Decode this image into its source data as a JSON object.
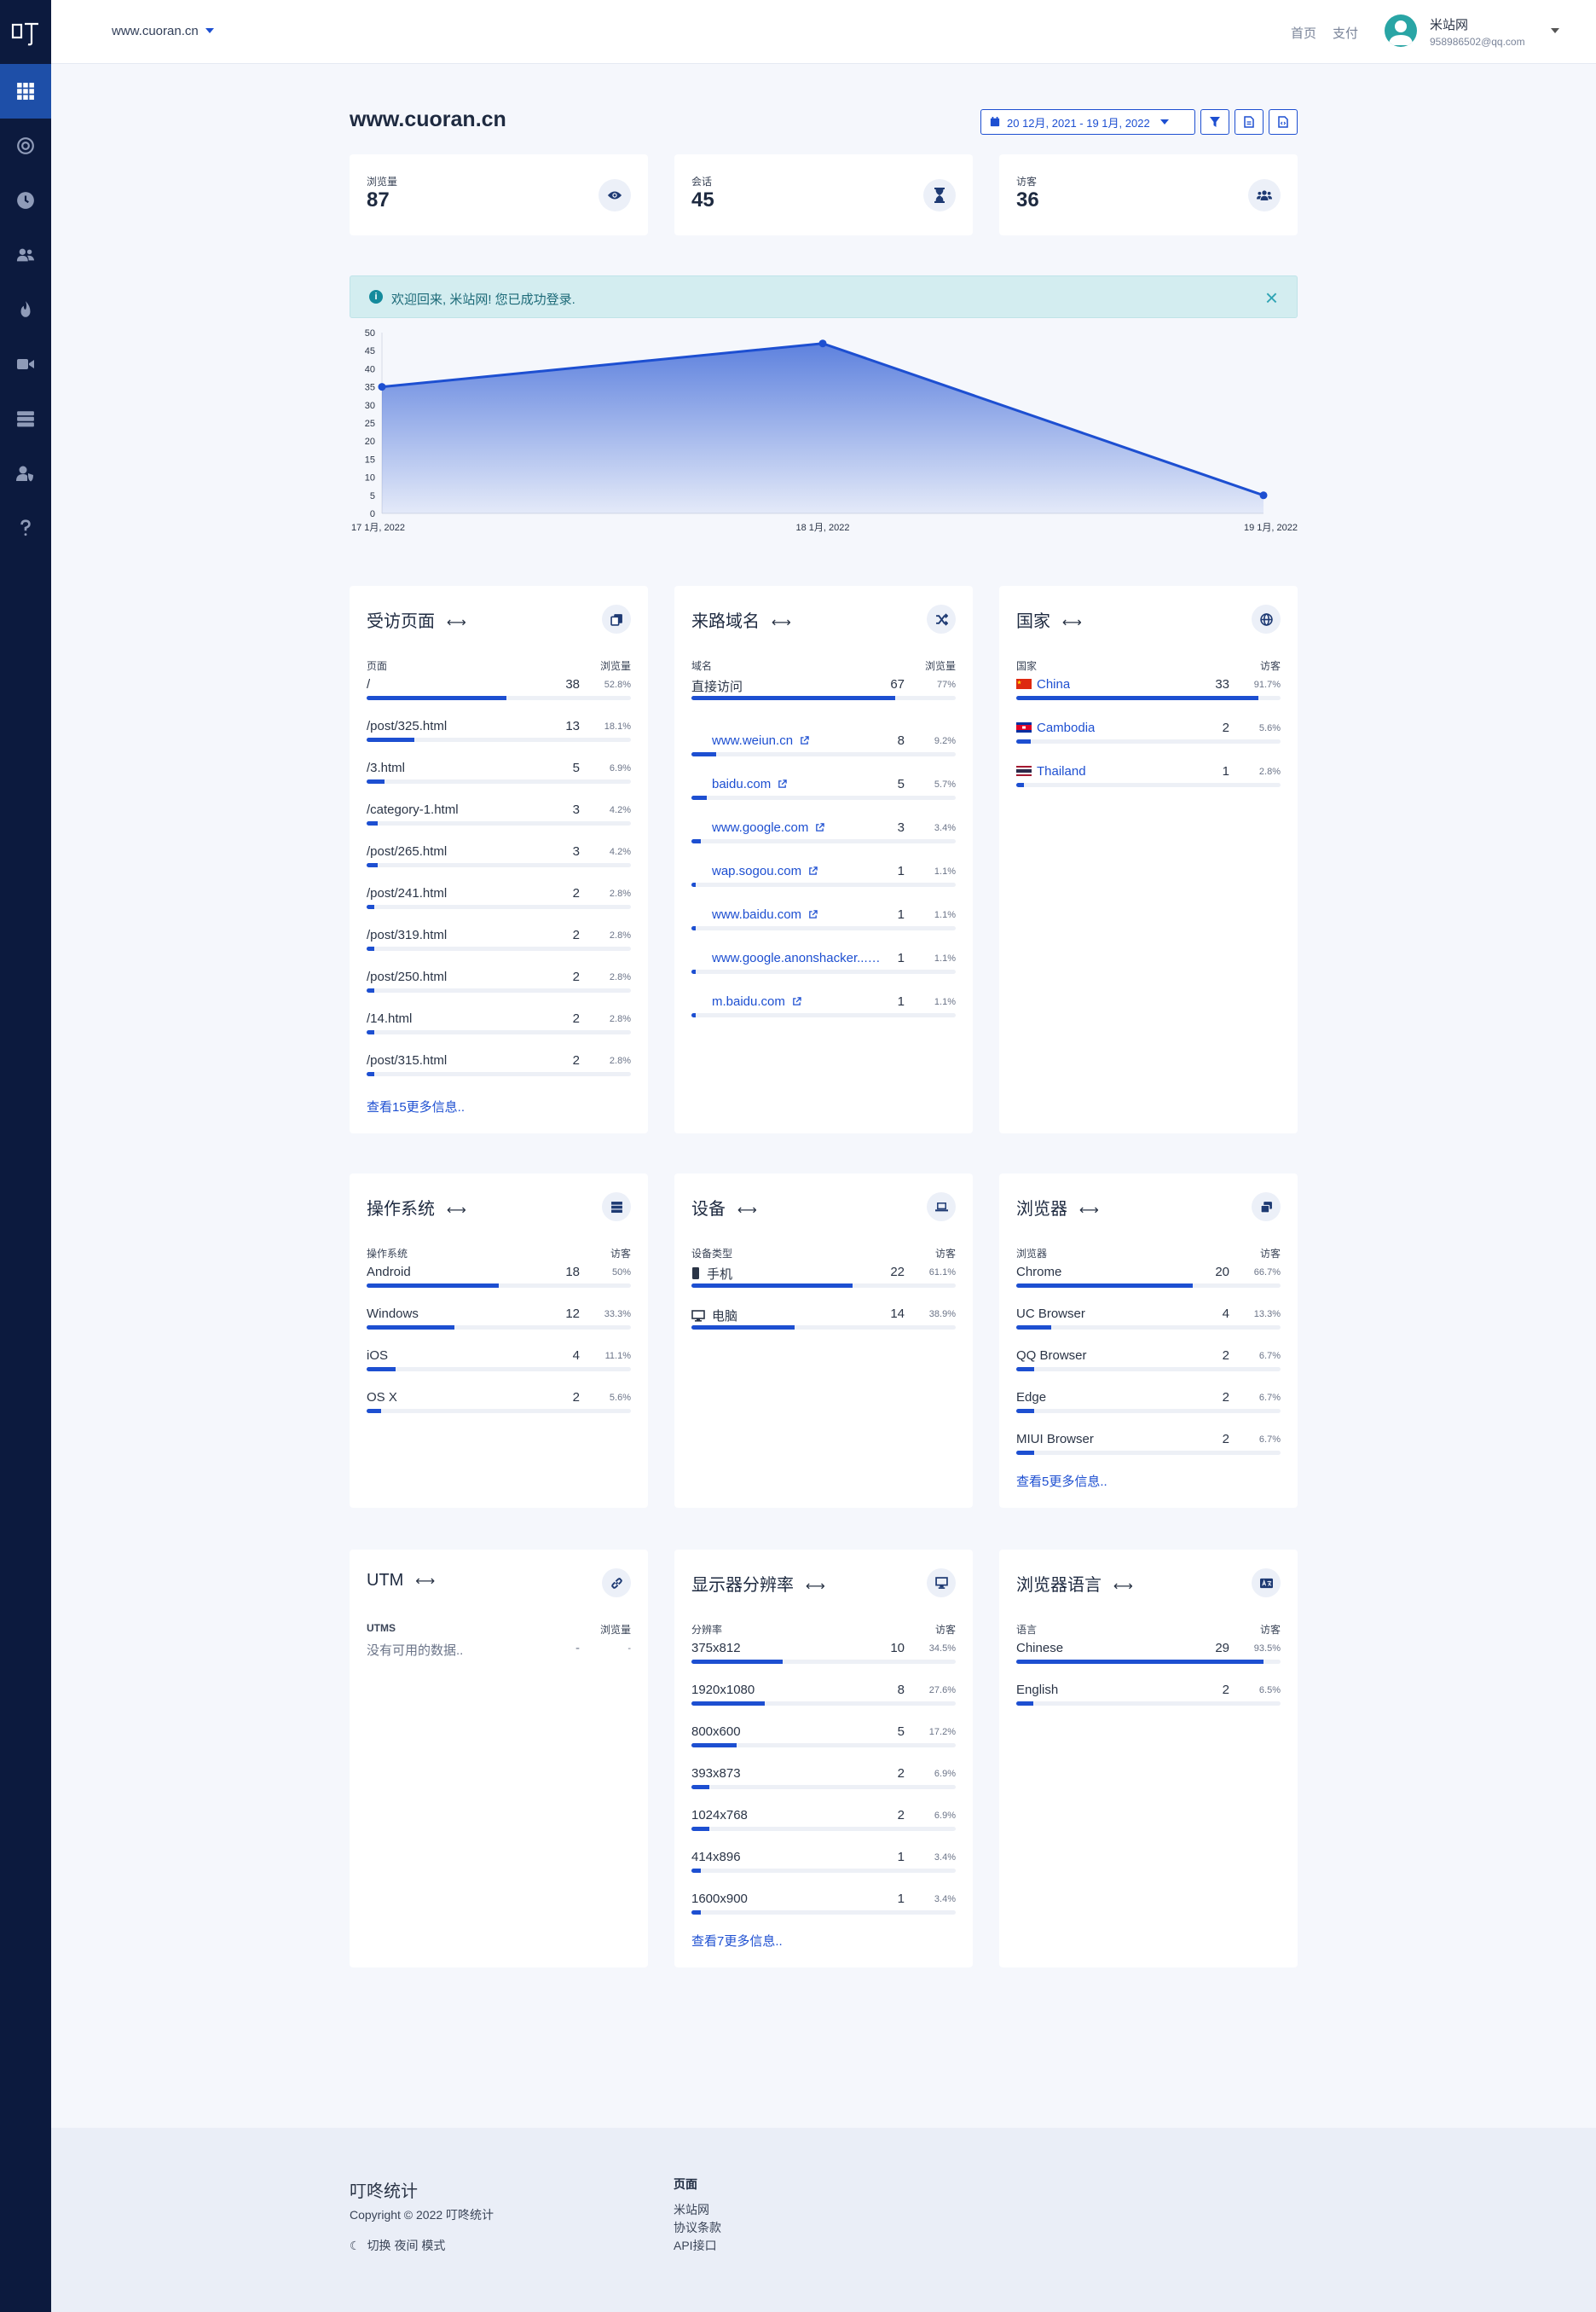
{
  "brand": {
    "logo_text": "叮"
  },
  "topbar": {
    "site": "www.cuoran.cn",
    "links": [
      "首页",
      "支付"
    ],
    "user_name": "米站网",
    "user_email": "958986502@qq.com"
  },
  "header": {
    "title": "www.cuoran.cn",
    "date_range": "20 12月, 2021 - 19 1月, 2022"
  },
  "stats": [
    {
      "label": "浏览量",
      "value": "87",
      "icon": "eye-icon"
    },
    {
      "label": "会话",
      "value": "45",
      "icon": "hourglass-icon"
    },
    {
      "label": "访客",
      "value": "36",
      "icon": "users-icon"
    }
  ],
  "alert": {
    "text": "欢迎回来, 米站网! 您已成功登录."
  },
  "chart_data": {
    "type": "area",
    "x": [
      "17 1月, 2022",
      "18 1月, 2022",
      "19 1月, 2022"
    ],
    "values": [
      35,
      47,
      5
    ],
    "ylim": [
      0,
      50
    ],
    "yticks": [
      0,
      5,
      10,
      15,
      20,
      25,
      30,
      35,
      40,
      45,
      50
    ],
    "color": "#1d4fd1"
  },
  "panels": {
    "pages": {
      "title": "受访页面",
      "col1": "页面",
      "col2": "浏览量",
      "more": "查看15更多信息..",
      "rows": [
        {
          "label": "/",
          "count": "38",
          "pct": "52.8%",
          "frac": 0.528
        },
        {
          "label": "/post/325.html",
          "count": "13",
          "pct": "18.1%",
          "frac": 0.181
        },
        {
          "label": "/3.html",
          "count": "5",
          "pct": "6.9%",
          "frac": 0.069
        },
        {
          "label": "/category-1.html",
          "count": "3",
          "pct": "4.2%",
          "frac": 0.042
        },
        {
          "label": "/post/265.html",
          "count": "3",
          "pct": "4.2%",
          "frac": 0.042
        },
        {
          "label": "/post/241.html",
          "count": "2",
          "pct": "2.8%",
          "frac": 0.028
        },
        {
          "label": "/post/319.html",
          "count": "2",
          "pct": "2.8%",
          "frac": 0.028
        },
        {
          "label": "/post/250.html",
          "count": "2",
          "pct": "2.8%",
          "frac": 0.028
        },
        {
          "label": "/14.html",
          "count": "2",
          "pct": "2.8%",
          "frac": 0.028
        },
        {
          "label": "/post/315.html",
          "count": "2",
          "pct": "2.8%",
          "frac": 0.028
        }
      ]
    },
    "referrers": {
      "title": "来路域名",
      "col1": "域名",
      "col2": "浏览量",
      "rows": [
        {
          "label": "直接访问",
          "count": "67",
          "pct": "77%",
          "frac": 0.77,
          "link": false
        },
        {
          "label": "www.weiun.cn",
          "count": "8",
          "pct": "9.2%",
          "frac": 0.092,
          "link": true
        },
        {
          "label": "baidu.com",
          "count": "5",
          "pct": "5.7%",
          "frac": 0.057,
          "link": true
        },
        {
          "label": "www.google.com",
          "count": "3",
          "pct": "3.4%",
          "frac": 0.034,
          "link": true
        },
        {
          "label": "wap.sogou.com",
          "count": "1",
          "pct": "1.1%",
          "frac": 0.011,
          "link": true
        },
        {
          "label": "www.baidu.com",
          "count": "1",
          "pct": "1.1%",
          "frac": 0.011,
          "link": true
        },
        {
          "label": "www.google.anonshacker....",
          "count": "1",
          "pct": "1.1%",
          "frac": 0.011,
          "link": true
        },
        {
          "label": "m.baidu.com",
          "count": "1",
          "pct": "1.1%",
          "frac": 0.011,
          "link": true
        }
      ]
    },
    "countries": {
      "title": "国家",
      "col1": "国家",
      "col2": "访客",
      "rows": [
        {
          "label": "China",
          "count": "33",
          "pct": "91.7%",
          "frac": 0.917,
          "flag": "cn"
        },
        {
          "label": "Cambodia",
          "count": "2",
          "pct": "5.6%",
          "frac": 0.056,
          "flag": "kh"
        },
        {
          "label": "Thailand",
          "count": "1",
          "pct": "2.8%",
          "frac": 0.028,
          "flag": "th"
        }
      ]
    },
    "os": {
      "title": "操作系统",
      "col1": "操作系统",
      "col2": "访客",
      "rows": [
        {
          "label": "Android",
          "count": "18",
          "pct": "50%",
          "frac": 0.5
        },
        {
          "label": "Windows",
          "count": "12",
          "pct": "33.3%",
          "frac": 0.333
        },
        {
          "label": "iOS",
          "count": "4",
          "pct": "11.1%",
          "frac": 0.111
        },
        {
          "label": "OS X",
          "count": "2",
          "pct": "5.6%",
          "frac": 0.056
        }
      ]
    },
    "devices": {
      "title": "设备",
      "col1": "设备类型",
      "col2": "访客",
      "rows": [
        {
          "label": "手机",
          "count": "22",
          "pct": "61.1%",
          "frac": 0.611,
          "icon": "phone-icon"
        },
        {
          "label": "电脑",
          "count": "14",
          "pct": "38.9%",
          "frac": 0.389,
          "icon": "desktop-icon"
        }
      ]
    },
    "browsers": {
      "title": "浏览器",
      "col1": "浏览器",
      "col2": "访客",
      "more": "查看5更多信息..",
      "rows": [
        {
          "label": "Chrome",
          "count": "20",
          "pct": "66.7%",
          "frac": 0.667
        },
        {
          "label": "UC Browser",
          "count": "4",
          "pct": "13.3%",
          "frac": 0.133
        },
        {
          "label": "QQ Browser",
          "count": "2",
          "pct": "6.7%",
          "frac": 0.067
        },
        {
          "label": "Edge",
          "count": "2",
          "pct": "6.7%",
          "frac": 0.067
        },
        {
          "label": "MIUI Browser",
          "count": "2",
          "pct": "6.7%",
          "frac": 0.067
        }
      ]
    },
    "utm": {
      "title": "UTM",
      "col1": "UTMS",
      "col2": "浏览量",
      "empty": {
        "label": "没有可用的数据..",
        "count": "-",
        "pct": "-"
      }
    },
    "resolutions": {
      "title": "显示器分辨率",
      "col1": "分辨率",
      "col2": "访客",
      "more": "查看7更多信息..",
      "rows": [
        {
          "label": "375x812",
          "count": "10",
          "pct": "34.5%",
          "frac": 0.345
        },
        {
          "label": "1920x1080",
          "count": "8",
          "pct": "27.6%",
          "frac": 0.276
        },
        {
          "label": "800x600",
          "count": "5",
          "pct": "17.2%",
          "frac": 0.172
        },
        {
          "label": "393x873",
          "count": "2",
          "pct": "6.9%",
          "frac": 0.069
        },
        {
          "label": "1024x768",
          "count": "2",
          "pct": "6.9%",
          "frac": 0.069
        },
        {
          "label": "414x896",
          "count": "1",
          "pct": "3.4%",
          "frac": 0.034
        },
        {
          "label": "1600x900",
          "count": "1",
          "pct": "3.4%",
          "frac": 0.034
        }
      ]
    },
    "languages": {
      "title": "浏览器语言",
      "col1": "语言",
      "col2": "访客",
      "rows": [
        {
          "label": "Chinese",
          "count": "29",
          "pct": "93.5%",
          "frac": 0.935
        },
        {
          "label": "English",
          "count": "2",
          "pct": "6.5%",
          "frac": 0.065
        }
      ]
    }
  },
  "footer": {
    "brand": "叮咚统计",
    "copyright": "Copyright © 2022 叮咚统计",
    "dark_mode": "切换 夜间 模式",
    "pages_heading": "页面",
    "links": [
      "米站网",
      "协议条款",
      "API接口"
    ]
  }
}
